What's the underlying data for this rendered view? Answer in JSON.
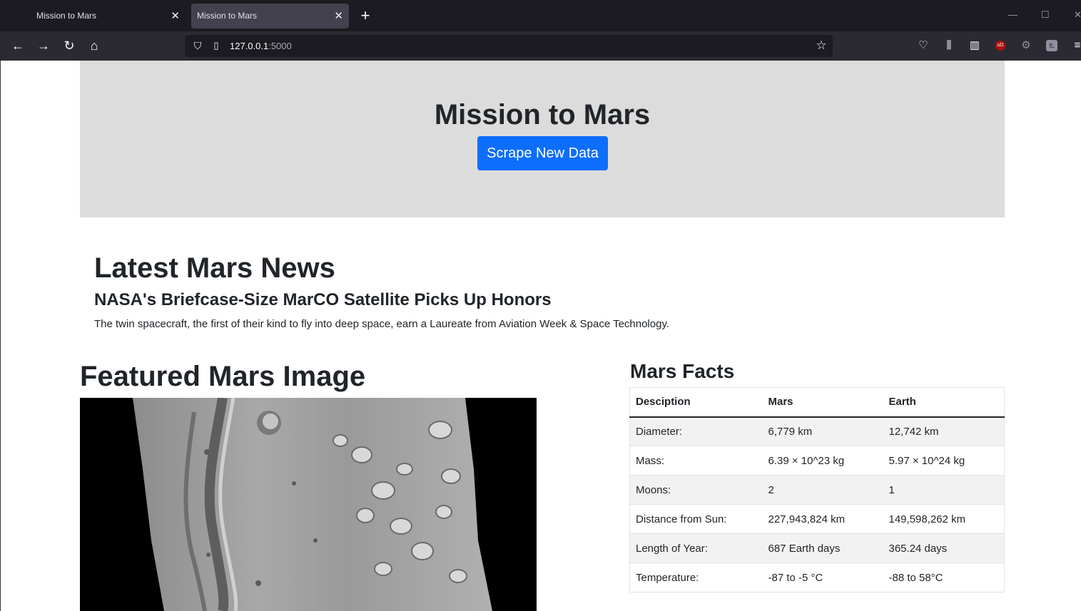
{
  "browser": {
    "tabs": [
      {
        "title": "Mission to Mars",
        "active": false
      },
      {
        "title": "Mission to Mars",
        "active": true
      }
    ],
    "url_host": "127.0.0.1",
    "url_port": ":5000",
    "icons": {
      "back": "arrow-left-icon",
      "forward": "arrow-right-icon",
      "reload": "reload-icon",
      "home": "home-icon",
      "shield": "shield-icon",
      "page": "page-icon",
      "bookmark": "star-icon",
      "pocket": "pocket-icon",
      "library": "library-icon",
      "sidebar": "sidebar-icon",
      "ublock": "ublock-icon",
      "extension1": "extension-icon",
      "extension2": "extension-icon",
      "menu": "hamburger-menu-icon"
    },
    "ublock_badge": "uD",
    "ext_badge": "fL"
  },
  "jumbotron": {
    "title": "Mission to Mars",
    "button_label": "Scrape New Data"
  },
  "news": {
    "heading": "Latest Mars News",
    "title": "NASA's Briefcase-Size MarCO Satellite Picks Up Honors",
    "paragraph": "The twin spacecraft, the first of their kind to fly into deep space, earn a Laureate from Aviation Week & Space Technology."
  },
  "featured": {
    "heading": "Featured Mars Image"
  },
  "facts": {
    "heading": "Mars Facts",
    "columns": [
      "Desciption",
      "Mars",
      "Earth"
    ],
    "rows": [
      [
        "Diameter:",
        "6,779 km",
        "12,742 km"
      ],
      [
        "Mass:",
        "6.39 × 10^23 kg",
        "5.97 × 10^24 kg"
      ],
      [
        "Moons:",
        "2",
        "1"
      ],
      [
        "Distance from Sun:",
        "227,943,824 km",
        "149,598,262 km"
      ],
      [
        "Length of Year:",
        "687 Earth days",
        "365.24 days"
      ],
      [
        "Temperature:",
        "-87 to -5 °C",
        "-88 to 58°C"
      ]
    ]
  },
  "colors": {
    "browser_tabbar": "#1c1b22",
    "browser_toolbar": "#2b2a33",
    "jumbotron_bg": "#dcdcdc",
    "button_primary": "#0d6efd",
    "table_stripe": "#f2f2f2"
  }
}
